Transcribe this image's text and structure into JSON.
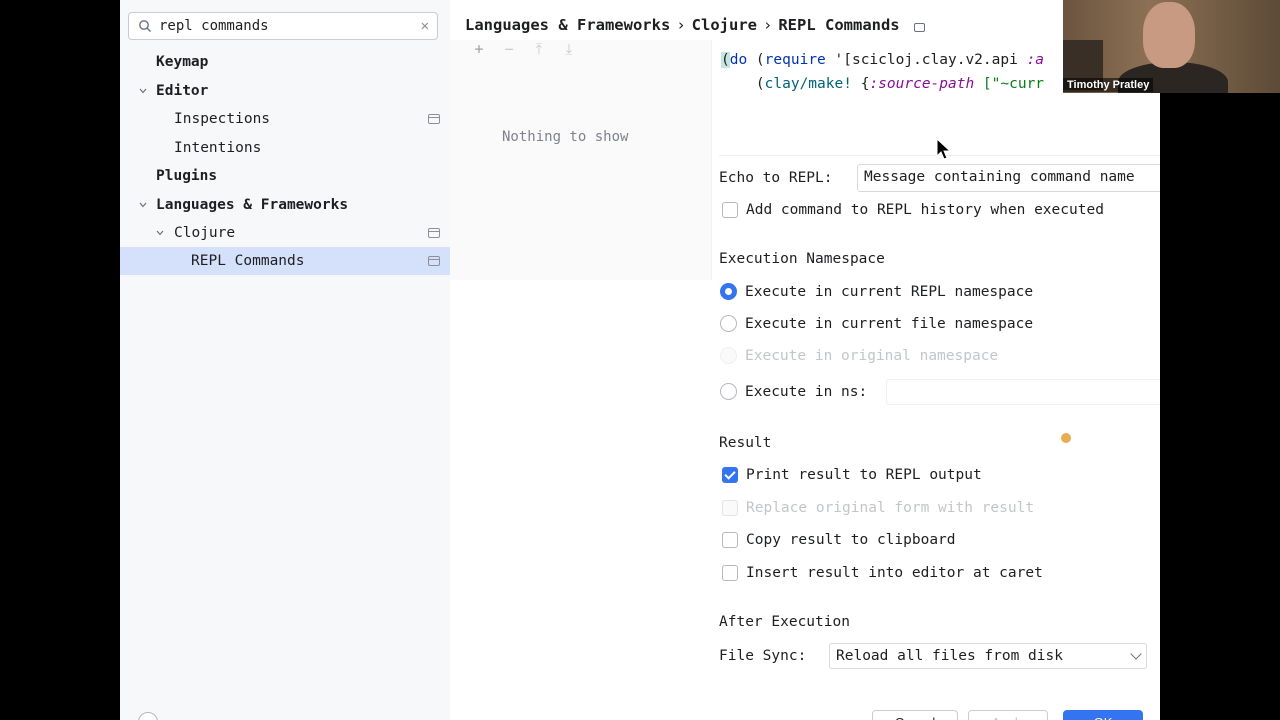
{
  "search": {
    "value": "repl commands",
    "placeholder": ""
  },
  "tree": {
    "items": [
      {
        "label": "Keymap"
      },
      {
        "label": "Editor"
      },
      {
        "label": "Inspections"
      },
      {
        "label": "Intentions"
      },
      {
        "label": "Plugins"
      },
      {
        "label": "Languages & Frameworks"
      },
      {
        "label": "Clojure"
      },
      {
        "label": "REPL Commands"
      }
    ]
  },
  "breadcrumb": [
    "Languages & Frameworks",
    "Clojure",
    "REPL Commands"
  ],
  "list": {
    "empty_message": "Nothing to show"
  },
  "code": {
    "line1": [
      "(",
      "do",
      " (",
      "require",
      " '[scicloj.clay.v2.api ",
      ":a"
    ],
    "line2": [
      "    (",
      "clay/make!",
      " {",
      ":source-path",
      " [\"~curr"
    ]
  },
  "echo": {
    "label": "Echo to REPL:",
    "value": "Message containing command name"
  },
  "history_check": {
    "label": "Add command to REPL history when executed",
    "checked": false
  },
  "namespace": {
    "title": "Execution Namespace",
    "options": [
      {
        "label": "Execute in current REPL namespace",
        "selected": true,
        "enabled": true
      },
      {
        "label": "Execute in current file namespace",
        "selected": false,
        "enabled": true
      },
      {
        "label": "Execute in original namespace",
        "selected": false,
        "enabled": false
      },
      {
        "label": "Execute in ns:",
        "selected": false,
        "enabled": true
      }
    ],
    "ns_value": ""
  },
  "result": {
    "title": "Result",
    "options": [
      {
        "label": "Print result to REPL output",
        "checked": true,
        "enabled": true
      },
      {
        "label": "Replace original form with result",
        "checked": false,
        "enabled": false
      },
      {
        "label": "Copy result to clipboard",
        "checked": false,
        "enabled": true
      },
      {
        "label": "Insert result into editor at caret",
        "checked": false,
        "enabled": true
      }
    ]
  },
  "after": {
    "title": "After Execution",
    "file_sync_label": "File Sync:",
    "file_sync_value": "Reload all files from disk"
  },
  "buttons": {
    "cancel": "Cancel",
    "apply": "Apply",
    "ok": "OK"
  },
  "video": {
    "name": "Timothy Pratley"
  }
}
